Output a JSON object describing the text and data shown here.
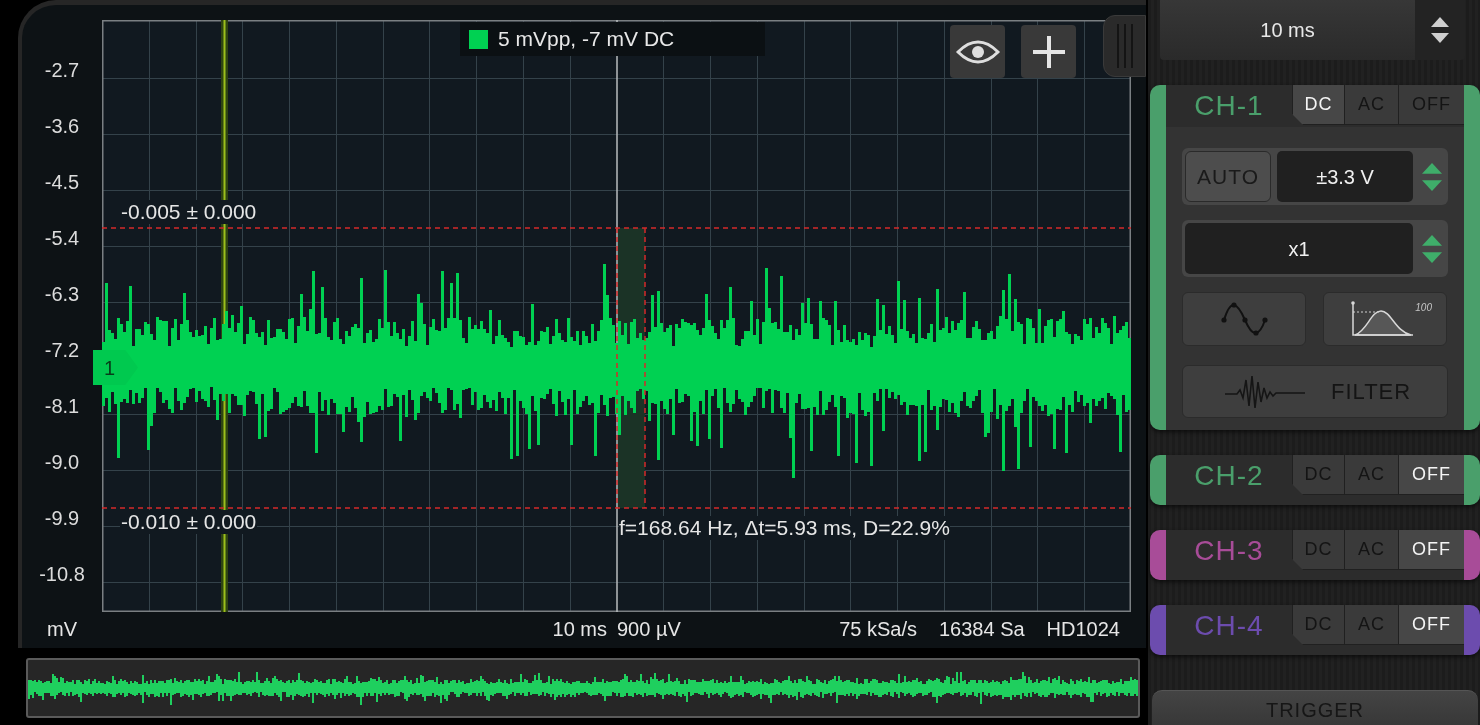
{
  "scope": {
    "legend": "5 mVpp, -7 mV DC",
    "y_axis_labels": [
      "-2.7",
      "-3.6",
      "-4.5",
      "-5.4",
      "-6.3",
      "-7.2",
      "-8.1",
      "-9.0",
      "-9.9",
      "-10.8"
    ],
    "y_unit": "mV",
    "cursor_labels": [
      "-0.005 ± 0.000",
      "-0.010 ± 0.000"
    ],
    "measurement": "f=168.64 Hz, Δt=5.93 ms, D=22.9%",
    "channel_marker": "1",
    "time_per_div": "10 ms",
    "volts_per_div": "900 µV",
    "sample_rate": "75 kSa/s",
    "sample_count": "16384 Sa",
    "resolution": "HD1024"
  },
  "timebase": "10 ms",
  "channels": [
    {
      "label": "CH-1",
      "color": "#4a9f6b",
      "expanded": true,
      "coupling": [
        {
          "label": "DC",
          "selected": true
        },
        {
          "label": "AC",
          "selected": false
        },
        {
          "label": "OFF",
          "selected": false
        }
      ],
      "controls": {
        "auto": "AUTO",
        "range": "±3.3 V",
        "probe": "x1",
        "distribution_max": "100",
        "filter": "FILTER"
      }
    },
    {
      "label": "CH-2",
      "color": "#4a9f6b",
      "expanded": false,
      "coupling": [
        {
          "label": "DC",
          "selected": false
        },
        {
          "label": "AC",
          "selected": false
        },
        {
          "label": "OFF",
          "selected": true
        }
      ]
    },
    {
      "label": "CH-3",
      "color": "#a84c98",
      "expanded": false,
      "coupling": [
        {
          "label": "DC",
          "selected": false
        },
        {
          "label": "AC",
          "selected": false
        },
        {
          "label": "OFF",
          "selected": true
        }
      ]
    },
    {
      "label": "CH-4",
      "color": "#6c4cae",
      "expanded": false,
      "coupling": [
        {
          "label": "DC",
          "selected": false
        },
        {
          "label": "AC",
          "selected": false
        },
        {
          "label": "OFF",
          "selected": true
        }
      ]
    }
  ],
  "trigger": "TRIGGER"
}
